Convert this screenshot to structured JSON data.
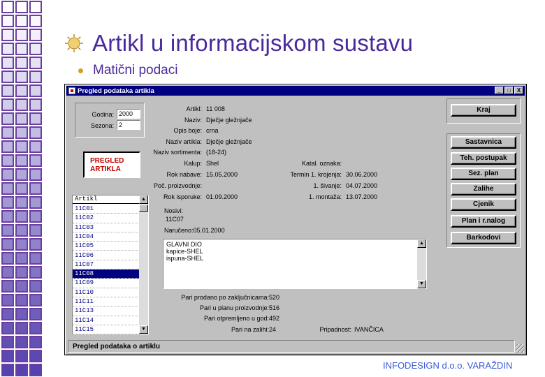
{
  "slide": {
    "title": "Artikl u informacijskom sustavu",
    "subtitle": "Matični podaci",
    "footer": "INFODESIGN d.o.o. VARAŽDIN"
  },
  "window": {
    "title": "Pregled podataka artikla",
    "controls": [
      "_",
      "□",
      "X"
    ],
    "godina_label": "Godina:",
    "godina_value": "2000",
    "sezona_label": "Sezona:",
    "sezona_value": "2",
    "pregled_line1": "PREGLED",
    "pregled_line2": "ARTIKLA",
    "details": [
      {
        "label": "Artikl:",
        "value": "11 008"
      },
      {
        "label": "Naziv:",
        "value": "Dječje gležnjače"
      },
      {
        "label": "Opis boje:",
        "value": "crna"
      },
      {
        "label": "Naziv artikla:",
        "value": "Dječje gležnjače"
      },
      {
        "label": "Naziv sortimenta:",
        "value": "(18-24)"
      },
      {
        "label": "Kalup:",
        "value": "Shel"
      },
      {
        "label": "Rok nabave:",
        "value": "15.05.2000"
      },
      {
        "label": "Poč. proizvodnje:",
        "value": ""
      },
      {
        "label": "Rok isporuke:",
        "value": "01.09.2000"
      }
    ],
    "right_details": [
      {
        "label": "Katal. oznaka:",
        "value": ""
      },
      {
        "label": "Termin 1. krojenja:",
        "value": "30.06.2000"
      },
      {
        "label": "1. šivanje:",
        "value": "04.07.2000"
      },
      {
        "label": "1. montaža:",
        "value": "13.07.2000"
      }
    ],
    "nosivi_label": "Nosivi:",
    "nosivi_value": "11C07",
    "naruceno": "Naručeno:05.01.2000",
    "memo_lines": [
      "GLAVNI DIO",
      "kapice-SHEL",
      "ispuna-SHEL"
    ],
    "list": {
      "header": "Artikl",
      "items": [
        "11C01",
        "11C02",
        "11C03",
        "11C04",
        "11C05",
        "11C06",
        "11C07",
        "11C08",
        "11C09",
        "11C10",
        "11C11",
        "11C13",
        "11C14",
        "11C15"
      ],
      "selected_index": 7
    },
    "stats": [
      {
        "label": "Pari prodano po zaključnicama:",
        "value": "520"
      },
      {
        "label": "Pari u planu proizvodnje:",
        "value": "516"
      },
      {
        "label": "Pari otpremljeno u god:",
        "value": "492"
      },
      {
        "label": "Pari na zalihi:",
        "value": "24"
      }
    ],
    "pripadnost_label": "Pripadnost:",
    "pripadnost_value": "IVANČICA",
    "buttons": {
      "kraj": "Kraj",
      "sastavnica": "Sastavnica",
      "teh_postupak": "Teh. postupak",
      "sez_plan": "Sez. plan",
      "zalihe": "Zalihe",
      "cjenik": "Cjenik",
      "plan_narudzbi": "Plan i r.nalog",
      "barkodovi": "Barkodovi"
    },
    "status": "Pregled podataka o artiklu"
  },
  "colors": {
    "title": "#4a2a9a",
    "titlebar": "#000080",
    "accent_red": "#c00000",
    "footer": "#3a5ad8",
    "grid": "#6a3fa0"
  }
}
